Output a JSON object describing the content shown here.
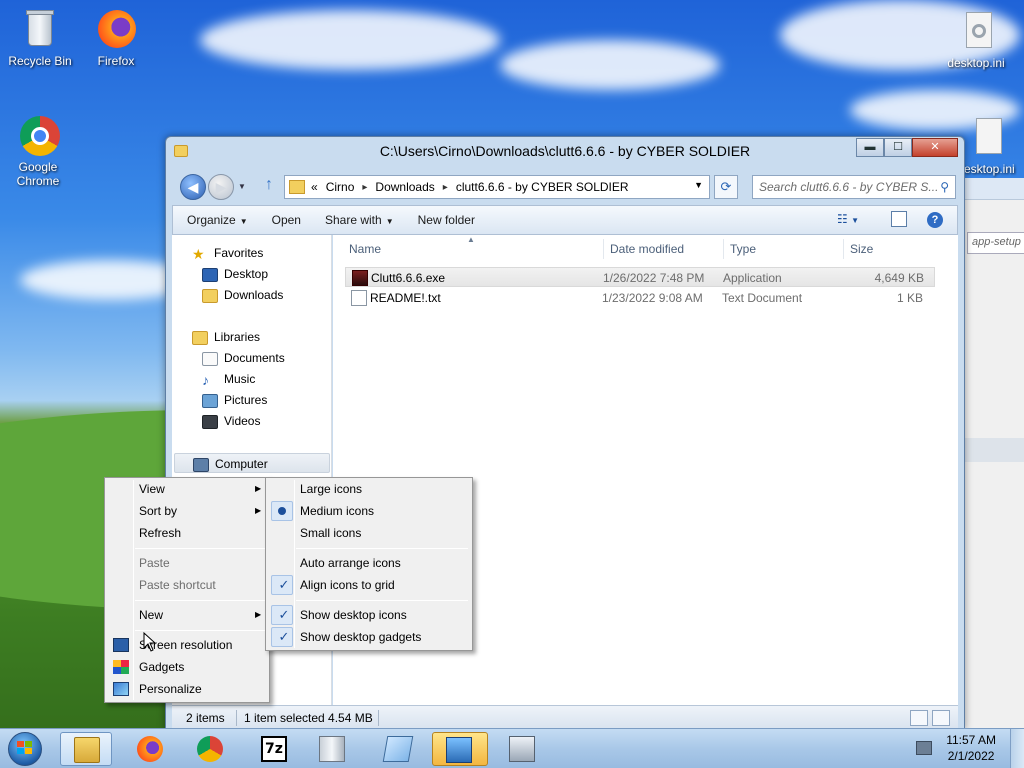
{
  "desktop": {
    "icons": [
      {
        "label": "Recycle Bin",
        "icon": "recycle-bin-icon"
      },
      {
        "label": "Firefox",
        "icon": "firefox-icon"
      },
      {
        "label": "Google Chrome",
        "icon": "chrome-icon"
      },
      {
        "label": "desktop.ini",
        "icon": "ini-file-icon"
      },
      {
        "label": "desktop.ini",
        "icon": "ini-file-icon"
      }
    ]
  },
  "background_window": {
    "search_placeholder": "app-setup"
  },
  "explorer": {
    "title": "C:\\Users\\Cirno\\Downloads\\clutt6.6.6 - by CYBER SOLDIER",
    "window_buttons": {
      "minimize": "▬",
      "maximize": "☐",
      "close": "✕"
    },
    "address": {
      "overflow": "«",
      "crumbs": [
        "Cirno",
        "Downloads",
        "clutt6.6.6 - by CYBER SOLDIER"
      ],
      "separator": "▸"
    },
    "search_placeholder": "Search clutt6.6.6 - by CYBER S...",
    "commands": {
      "organize": "Organize",
      "open": "Open",
      "share_with": "Share with",
      "new_folder": "New folder"
    },
    "nav": {
      "favorites": "Favorites",
      "desktop": "Desktop",
      "downloads": "Downloads",
      "libraries": "Libraries",
      "documents": "Documents",
      "music": "Music",
      "pictures": "Pictures",
      "videos": "Videos",
      "computer": "Computer"
    },
    "columns": {
      "name": "Name",
      "date_modified": "Date modified",
      "type": "Type",
      "size": "Size"
    },
    "files": [
      {
        "name": "Clutt6.6.6.exe",
        "date": "1/26/2022 7:48 PM",
        "type": "Application",
        "size": "4,649 KB",
        "selected": true
      },
      {
        "name": "README!.txt",
        "date": "1/23/2022 9:08 AM",
        "type": "Text Document",
        "size": "1 KB",
        "selected": false
      }
    ],
    "status": {
      "items": "2 items",
      "selection": "1 item selected  4.54 MB"
    }
  },
  "context_menu": {
    "items": {
      "view": "View",
      "sort_by": "Sort by",
      "refresh": "Refresh",
      "paste": "Paste",
      "paste_shortcut": "Paste shortcut",
      "new": "New",
      "screen_resolution": "Screen resolution",
      "gadgets": "Gadgets",
      "personalize": "Personalize"
    },
    "submenu_arrow": "▶"
  },
  "view_submenu": {
    "large_icons": "Large icons",
    "medium_icons": "Medium icons",
    "small_icons": "Small icons",
    "auto_arrange": "Auto arrange icons",
    "align_to_grid": "Align icons to grid",
    "show_desktop_icons": "Show desktop icons",
    "show_desktop_gadgets": "Show desktop gadgets",
    "selected_size": "Medium icons",
    "checked": [
      "Align icons to grid",
      "Show desktop icons",
      "Show desktop gadgets"
    ]
  },
  "taskbar": {
    "pinned": [
      "explorer-icon",
      "firefox-icon",
      "chrome-icon",
      "7zip-icon",
      "trash-icon",
      "notepad-icon",
      "warning-app-icon",
      "setup-icon"
    ],
    "sevenzip_label": "7z",
    "time": "11:57 AM",
    "date": "2/1/2022"
  },
  "colors": {
    "selection_blue": "#1c4f9b",
    "window_frame": "#c9dcef"
  }
}
